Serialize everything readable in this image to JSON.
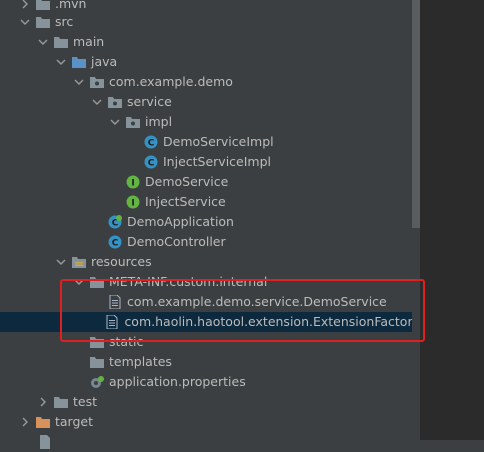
{
  "tree": {
    "mvn": ".mvn",
    "src": "src",
    "main": "main",
    "java": "java",
    "pkg": "com.example.demo",
    "service": "service",
    "impl": "impl",
    "demo_service_impl": "DemoServiceImpl",
    "inject_service_impl": "InjectServiceImpl",
    "demo_service": "DemoService",
    "inject_service": "InjectService",
    "demo_application": "DemoApplication",
    "demo_controller": "DemoController",
    "resources": "resources",
    "meta_inf": "META-INF.custom.internal",
    "file1": "com.example.demo.service.DemoService",
    "file2": "com.haolin.haotool.extension.ExtensionFactory",
    "static": "static",
    "templates": "templates",
    "app_props": "application.properties",
    "test": "test",
    "target": "target"
  },
  "colors": {
    "folder": "#87939a",
    "source_folder": "#5a92c8",
    "class_icon": "#3592c4",
    "interface_icon": "#62b543",
    "target_folder": "#d9915b",
    "selection": "#0d293e",
    "highlight_border": "#e02020"
  }
}
